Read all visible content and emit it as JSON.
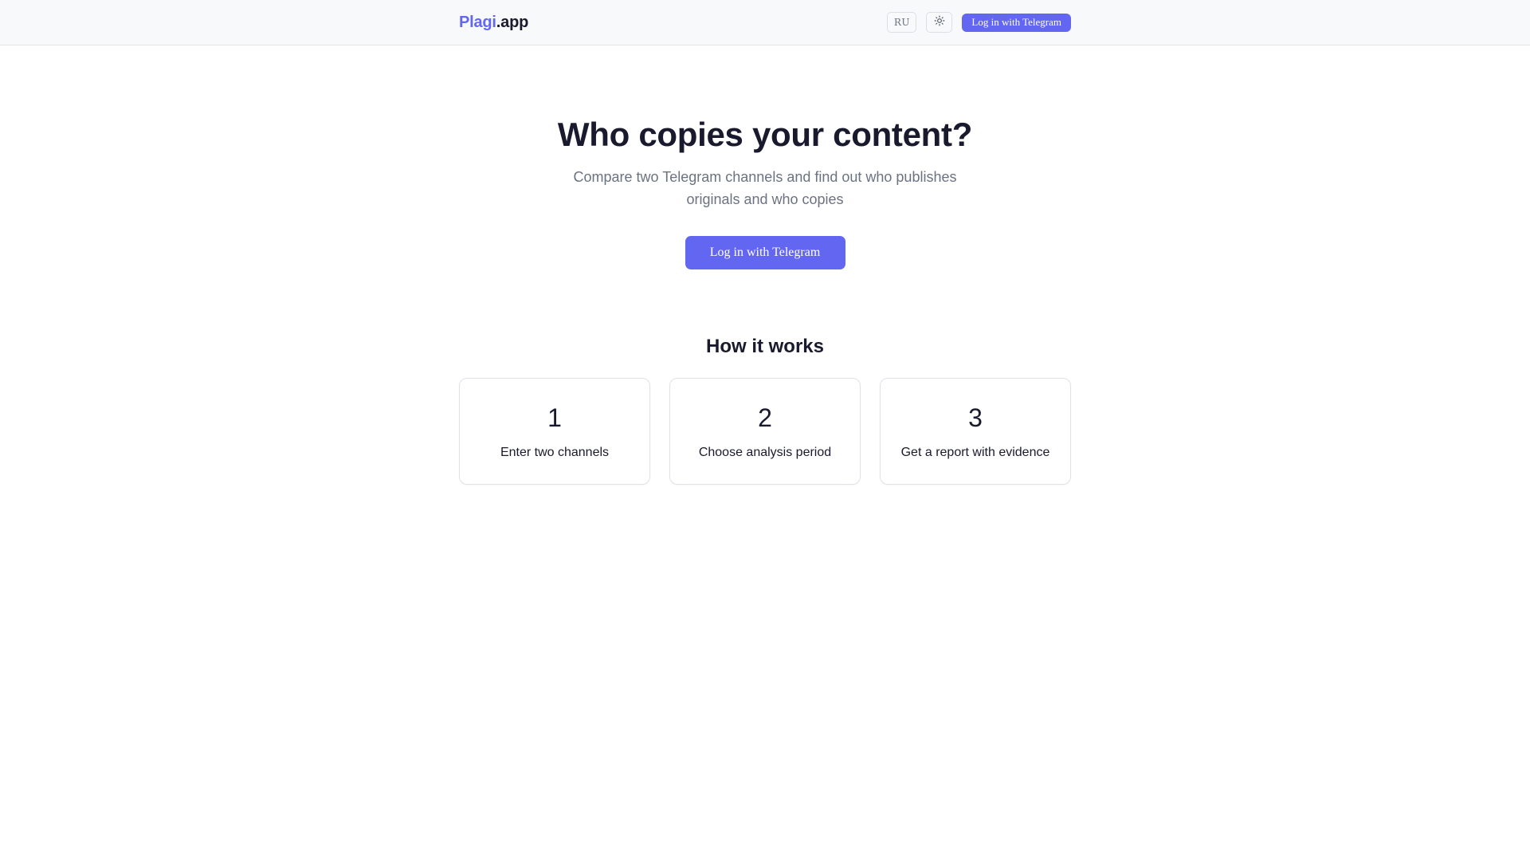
{
  "header": {
    "logo_brand": "Plagi",
    "logo_tld": ".app",
    "lang_label": "RU",
    "theme_icon": "sun-icon",
    "login_label": "Log in with Telegram"
  },
  "hero": {
    "title": "Who copies your content?",
    "subtitle": "Compare two Telegram channels and find out who publishes originals and who copies",
    "cta_label": "Log in with Telegram"
  },
  "how_it_works": {
    "title": "How it works",
    "steps": [
      {
        "number": "1",
        "label": "Enter two channels"
      },
      {
        "number": "2",
        "label": "Choose analysis period"
      },
      {
        "number": "3",
        "label": "Get a report with evidence"
      }
    ]
  },
  "colors": {
    "accent": "#6366f1",
    "text": "#1a1a2e",
    "muted": "#6b7280",
    "header_bg": "#f8f9fa"
  }
}
